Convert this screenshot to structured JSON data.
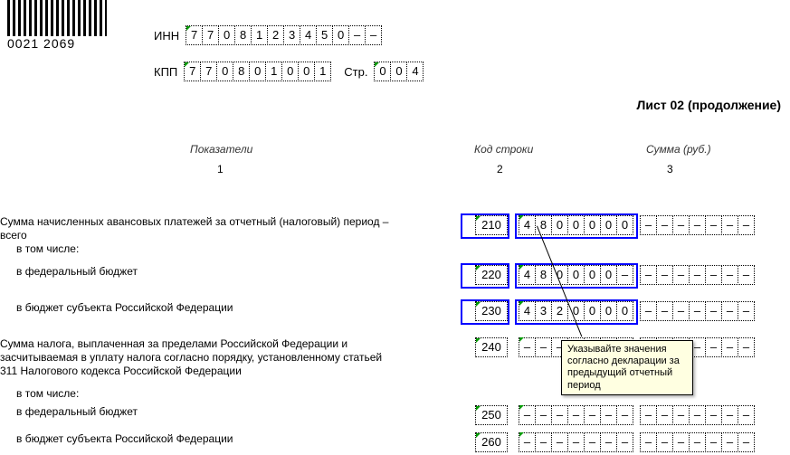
{
  "barcode_text": "0021 2069",
  "inn_label": "ИНН",
  "inn_cells": [
    "7",
    "7",
    "0",
    "8",
    "1",
    "2",
    "3",
    "4",
    "5",
    "0",
    "–",
    "–"
  ],
  "kpp_label": "КПП",
  "kpp_cells": [
    "7",
    "7",
    "0",
    "8",
    "0",
    "1",
    "0",
    "0",
    "1"
  ],
  "page_label": "Стр.",
  "page_cells": [
    "0",
    "0",
    "4"
  ],
  "sheet_title": "Лист 02 (продолжение)",
  "headers": {
    "c1": "Показатели",
    "c2": "Код строки",
    "c3": "Сумма (руб.)"
  },
  "subheaders": {
    "c1": "1",
    "c2": "2",
    "c3": "3"
  },
  "sum_empty": [
    "–",
    "–",
    "–",
    "–",
    "–",
    "–",
    "–"
  ],
  "rows": [
    {
      "label": "Сумма начисленных авансовых платежей за отчетный (налоговый) период – всего",
      "code": "210",
      "sum": [
        "4",
        "8",
        "0",
        "0",
        "0",
        "0",
        "0"
      ],
      "highlight": true
    },
    {
      "label": "в том числе:",
      "indent": true
    },
    {
      "label": "в федеральный бюджет",
      "indent": true,
      "code": "220",
      "sum": [
        "4",
        "8",
        "0",
        "0",
        "0",
        "0",
        "–"
      ],
      "highlight": true
    },
    {
      "label": "в бюджет субъекта Российской Федерации",
      "indent": true,
      "code": "230",
      "sum": [
        "4",
        "3",
        "2",
        "0",
        "0",
        "0",
        "0"
      ],
      "highlight": true
    },
    {
      "label": "Сумма налога, выплаченная за пределами Российской Федерации и засчитываемая в уплату налога согласно порядку, установленному статьей 311 Налогового кодекса Российской Федерации",
      "code": "240",
      "sum": [
        "–",
        "–",
        "–",
        "–",
        "–",
        "–",
        "–"
      ]
    },
    {
      "label": "в том числе:",
      "indent": true
    },
    {
      "label": "в федеральный бюджет",
      "indent": true,
      "code": "250",
      "sum": [
        "–",
        "–",
        "–",
        "–",
        "–",
        "–",
        "–"
      ]
    },
    {
      "label": "в бюджет субъекта Российской Федерации",
      "indent": true,
      "code": "260",
      "sum": [
        "–",
        "–",
        "–",
        "–",
        "–",
        "–",
        "–"
      ]
    }
  ],
  "tooltip": "Указывайте значения согласно декларации за предыдущий отчетный период"
}
